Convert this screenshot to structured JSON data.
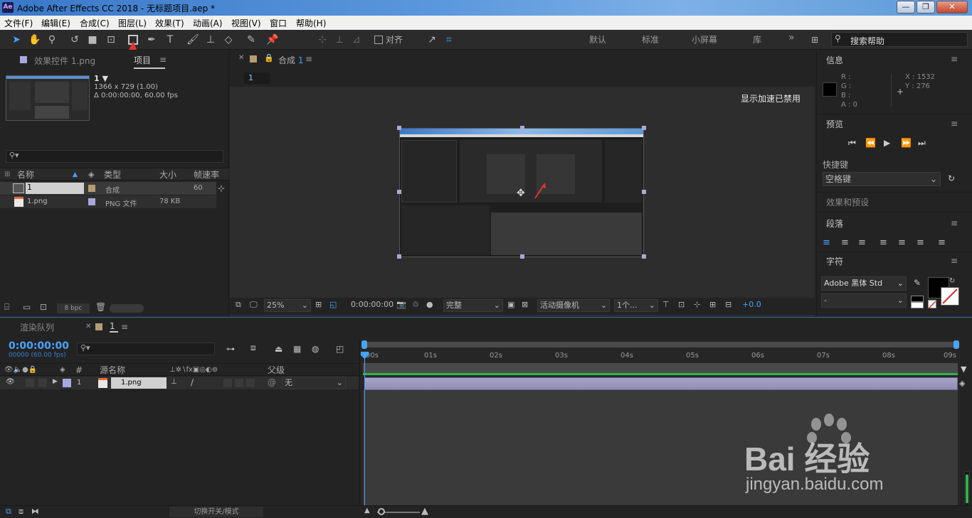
{
  "window": {
    "title": "Adobe After Effects CC 2018 - 无标题项目.aep *",
    "logo": "Ae",
    "min": "—",
    "max": "❐",
    "close": "✕"
  },
  "menu": [
    "文件(F)",
    "编辑(E)",
    "合成(C)",
    "图层(L)",
    "效果(T)",
    "动画(A)",
    "视图(V)",
    "窗口",
    "帮助(H)"
  ],
  "toolbar": {
    "align_label": "对齐",
    "workspaces": [
      "默认",
      "标准",
      "小屏幕",
      "库"
    ],
    "more": "»",
    "search_placeholder": "搜索帮助"
  },
  "project_panel": {
    "tab_effects": "效果控件 1.png",
    "tab_project": "项目",
    "comp_name": "1 ▼",
    "comp_size": "1366 x 729 (1.00)",
    "comp_duration": "Δ 0:00:00:00, 60.00 fps",
    "columns": {
      "name": "名称",
      "type": "类型",
      "size": "大小",
      "fps": "帧速率"
    },
    "items": [
      {
        "name": "1",
        "type": "合成",
        "size": "",
        "fps": "60",
        "color": "#b59c74"
      },
      {
        "name": "1.png",
        "type": "PNG 文件",
        "size": "78 KB",
        "fps": "",
        "color": "#a8a8e0"
      }
    ],
    "bpc": "8 bpc"
  },
  "comp_panel": {
    "tab_label": "合成",
    "tab_num": "1",
    "subtab": "1",
    "accel_notice": "显示加速已禁用",
    "zoom": "25%",
    "timecode": "0:00:00:00",
    "quality": "完整",
    "camera": "活动摄像机",
    "views": "1个...",
    "exposure": "+0.0"
  },
  "info_panel": {
    "title": "信息",
    "r": "R :",
    "g": "G :",
    "b": "B :",
    "a": "A : 0",
    "x": "X : 1532",
    "y": "Y : 276"
  },
  "preview_panel": {
    "title": "预览"
  },
  "shortcut": {
    "label": "快捷键",
    "value": "空格键"
  },
  "effects_presets": {
    "title": "效果和预设"
  },
  "paragraph": {
    "title": "段落"
  },
  "character": {
    "title": "字符",
    "font": "Adobe 黑体 Std",
    "style": "-"
  },
  "timeline": {
    "tab_render": "渲染队列",
    "tab_comp": "1",
    "timecode": "0:00:00:00",
    "frames": "00000 (60.00 fps)",
    "col_num": "#",
    "col_source": "源名称",
    "col_parent": "父级",
    "layer": {
      "num": "1",
      "name": "1.png",
      "parent": "无"
    },
    "ruler": [
      "00s",
      "01s",
      "02s",
      "03s",
      "04s",
      "05s",
      "06s",
      "07s",
      "08s",
      "09s"
    ],
    "footer": "切换开关/模式"
  },
  "watermark": {
    "brand": "Bai  经验",
    "url": "jingyan.baidu.com"
  }
}
